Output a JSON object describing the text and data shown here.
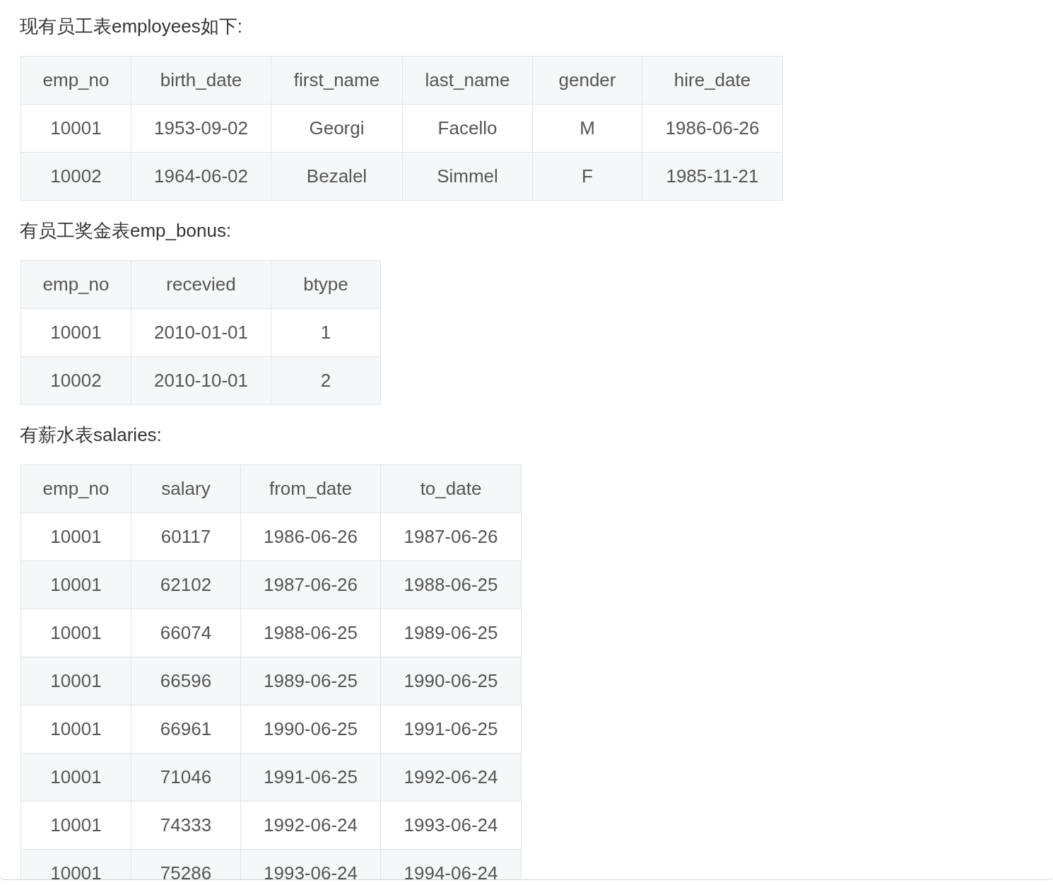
{
  "sections": [
    {
      "heading": "现有员工表employees如下:",
      "columns": [
        "emp_no",
        "birth_date",
        "first_name",
        "last_name",
        "gender",
        "hire_date"
      ],
      "rows": [
        [
          "10001",
          "1953-09-02",
          "Georgi",
          "Facello",
          "M",
          "1986-06-26"
        ],
        [
          "10002",
          "1964-06-02",
          "Bezalel",
          "Simmel",
          "F",
          "1985-11-21"
        ]
      ]
    },
    {
      "heading": "有员工奖金表emp_bonus:",
      "columns": [
        "emp_no",
        "recevied",
        "btype"
      ],
      "rows": [
        [
          "10001",
          "2010-01-01",
          "1"
        ],
        [
          "10002",
          "2010-10-01",
          "2"
        ]
      ]
    },
    {
      "heading": "有薪水表salaries:",
      "columns": [
        "emp_no",
        "salary",
        "from_date",
        "to_date"
      ],
      "rows": [
        [
          "10001",
          "60117",
          "1986-06-26",
          "1987-06-26"
        ],
        [
          "10001",
          "62102",
          "1987-06-26",
          "1988-06-25"
        ],
        [
          "10001",
          "66074",
          "1988-06-25",
          "1989-06-25"
        ],
        [
          "10001",
          "66596",
          "1989-06-25",
          "1990-06-25"
        ],
        [
          "10001",
          "66961",
          "1990-06-25",
          "1991-06-25"
        ],
        [
          "10001",
          "71046",
          "1991-06-25",
          "1992-06-24"
        ],
        [
          "10001",
          "74333",
          "1992-06-24",
          "1993-06-24"
        ],
        [
          "10001",
          "75286",
          "1993-06-24",
          "1994-06-24"
        ]
      ]
    }
  ]
}
